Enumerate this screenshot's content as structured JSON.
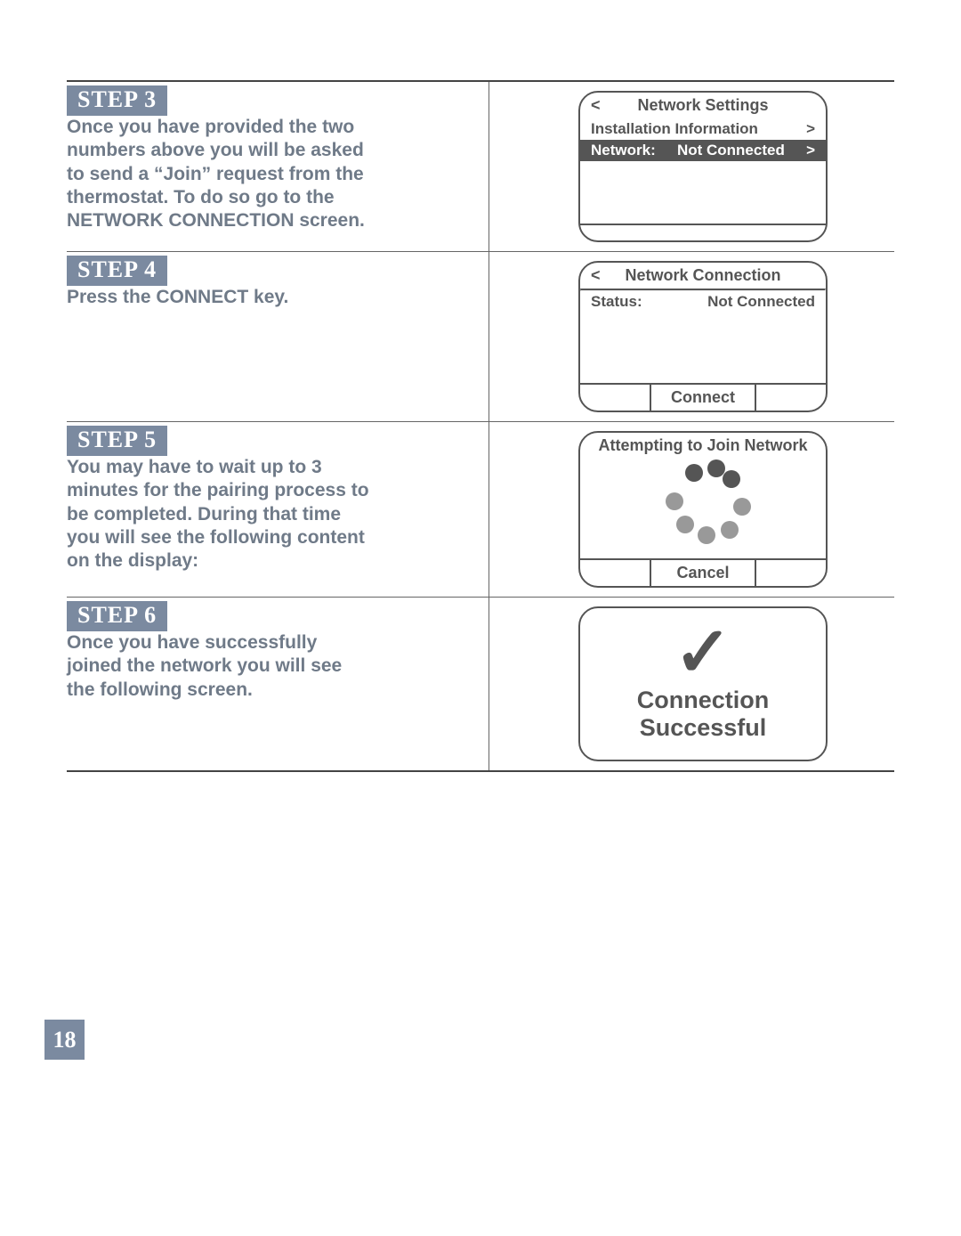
{
  "page_number": "18",
  "steps": {
    "s3": {
      "label": "STEP 3",
      "text": "Once you have provided the two numbers above you will be asked to send a “Join” request from the thermostat. To do so go to the NETWORK CONNECTION screen."
    },
    "s4": {
      "label": "STEP 4",
      "text": "Press the CONNECT key."
    },
    "s5": {
      "label": "STEP 5",
      "text": "You may have to wait up to 3 minutes for the pairing process to be completed. During that time you will see the following content on the display:"
    },
    "s6": {
      "label": "STEP 6",
      "text": "Once you have successfully joined the network you will see the following screen."
    }
  },
  "screens": {
    "network_settings": {
      "title": "Network Settings",
      "row1_left": "Installation Information",
      "row2_left": "Network:",
      "row2_right": "Not Connected",
      "caret_l": "<",
      "caret_r": ">"
    },
    "network_connection": {
      "title": "Network Connection",
      "status_label": "Status:",
      "status_value": "Not Connected",
      "caret_l": "<",
      "footer_btn": "Connect"
    },
    "joining": {
      "title": "Attempting to Join Network",
      "footer_btn": "Cancel"
    },
    "success": {
      "check": "✓",
      "line1": "Connection",
      "line2": "Successful"
    }
  }
}
